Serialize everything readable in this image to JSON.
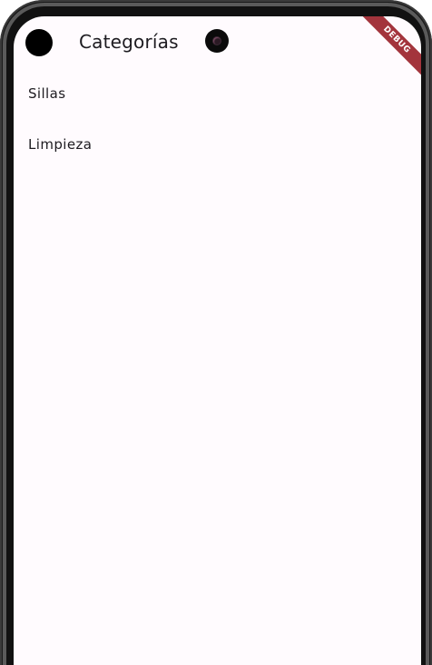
{
  "app_bar": {
    "title": "Categorías",
    "leading_icon": "avatar-dot"
  },
  "debug_banner": {
    "label": "DEBUG",
    "color": "#a3343c"
  },
  "categories": [
    {
      "label": "Sillas"
    },
    {
      "label": "Limpieza"
    }
  ],
  "colors": {
    "background": "#fffbfe",
    "text": "#1d1b20"
  }
}
